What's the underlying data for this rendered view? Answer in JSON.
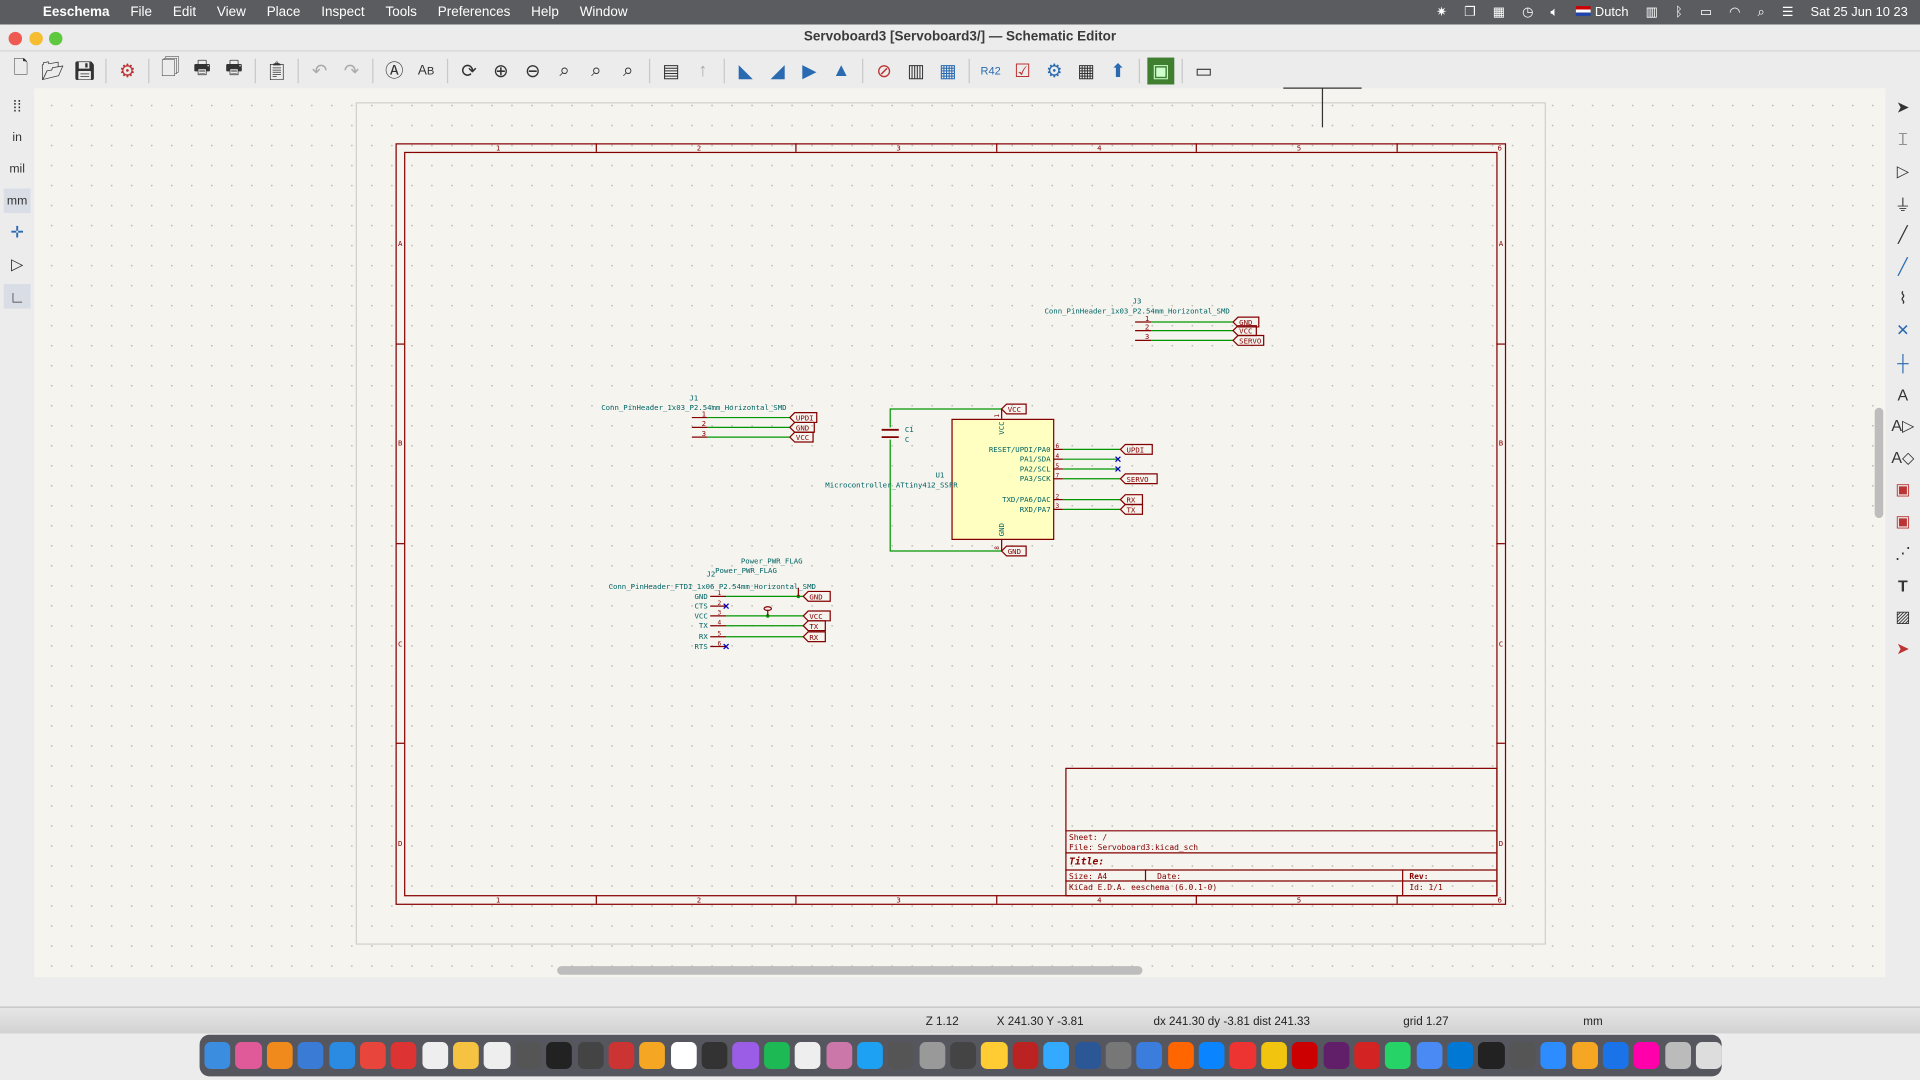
{
  "menubar": {
    "app": "Eeschema",
    "items": [
      "File",
      "Edit",
      "View",
      "Place",
      "Inspect",
      "Tools",
      "Preferences",
      "Help",
      "Window"
    ],
    "input_source": "Dutch",
    "clock": "Sat 25 Jun  10 23"
  },
  "window": {
    "title": "Servoboard3 [Servoboard3/] — Schematic Editor"
  },
  "toolbar": {
    "icons": [
      "new-icon",
      "open-icon",
      "save-icon",
      "page-settings-icon",
      "new-sheet-icon",
      "print-icon",
      "plot-icon",
      "paste-icon",
      "undo-icon",
      "redo-icon",
      "find-icon",
      "find-replace-icon",
      "refresh-icon",
      "zoom-in-icon",
      "zoom-out-icon",
      "zoom-fit-icon",
      "zoom-objects-icon",
      "zoom-selection-icon",
      "hierarchy-icon",
      "leave-sheet-icon",
      "rotate-ccw-icon",
      "rotate-cw-icon",
      "mirror-v-icon",
      "mirror-h-icon",
      "symbol-editor-icon",
      "symbol-browser-icon",
      "annotate-icon",
      "erc-icon",
      "symbol-fields-icon",
      "bom-icon",
      "footprint-assign-icon",
      "pcb-editor-icon",
      "scripting-console-icon"
    ]
  },
  "left_toolbar": {
    "units": {
      "inch": "in",
      "mil": "mil",
      "mm": "mm"
    }
  },
  "schematic": {
    "columns": [
      "1",
      "2",
      "3",
      "4",
      "5",
      "6"
    ],
    "rows": [
      "A",
      "B",
      "C",
      "D"
    ],
    "J1": {
      "ref": "J1",
      "value": "Conn_PinHeader_1x03_P2.54mm_Horizontal_SMD",
      "pins": [
        "1",
        "2",
        "3"
      ],
      "labels": [
        "UPDI",
        "GND",
        "VCC"
      ]
    },
    "J3": {
      "ref": "J3",
      "value": "Conn_PinHeader_1x03_P2.54mm_Horizontal_SMD",
      "pins": [
        "1",
        "2",
        "3"
      ],
      "labels": [
        "GND",
        "VCC",
        "SERVO"
      ]
    },
    "C1": {
      "ref": "C1",
      "value": "C"
    },
    "U1": {
      "ref": "U1",
      "value": "Microcontroller_ATtiny412_SSFR",
      "top_pin": {
        "name": "VCC",
        "num": "1",
        "label": "VCC"
      },
      "bottom_pin": {
        "name": "GND",
        "num": "8",
        "label": "GND"
      },
      "right_pins": [
        {
          "name": "RESET/UPDI/PA0",
          "num": "6",
          "label": "UPDI"
        },
        {
          "name": "PA1/SDA",
          "num": "4",
          "label": ""
        },
        {
          "name": "PA2/SCL",
          "num": "5",
          "label": ""
        },
        {
          "name": "PA3/SCK",
          "num": "7",
          "label": "SERVO"
        },
        {
          "name": "TXD/PA6/DAC",
          "num": "2",
          "label": "RX"
        },
        {
          "name": "RXD/PA7",
          "num": "3",
          "label": "TX"
        }
      ]
    },
    "J2": {
      "ref": "J2",
      "value": "Conn_PinHeader_FTDI_1x06_P2.54mm_Horizontal_SMD",
      "flag1": "Power_PWR_FLAG",
      "flag2": "Power_PWR_FLAG",
      "pins": [
        {
          "name": "GND",
          "num": "1",
          "label": "GND"
        },
        {
          "name": "CTS",
          "num": "2",
          "label": ""
        },
        {
          "name": "VCC",
          "num": "3",
          "label": "VCC"
        },
        {
          "name": "TX",
          "num": "4",
          "label": "TX"
        },
        {
          "name": "RX",
          "num": "5",
          "label": "RX"
        },
        {
          "name": "RTS",
          "num": "6",
          "label": ""
        }
      ]
    },
    "title_block": {
      "sheet": "Sheet: /",
      "file": "File: Servoboard3.kicad_sch",
      "title": "Title:",
      "size": "Size: A4",
      "date": "Date:",
      "rev": "Rev:",
      "tool": "KiCad E.D.A.  eeschema (6.0.1-0)",
      "id": "Id: 1/1"
    }
  },
  "statusbar": {
    "zoom": "Z 1.12",
    "xy": "X 241.30  Y -3.81",
    "delta": "dx 241.30  dy -3.81  dist 241.33",
    "grid": "grid 1.27",
    "units": "mm"
  },
  "colors": {
    "wire": "#009600",
    "symbol": "#840000",
    "body": "#ffffc2",
    "text": "#006464",
    "noconnect": "#0000c8"
  }
}
